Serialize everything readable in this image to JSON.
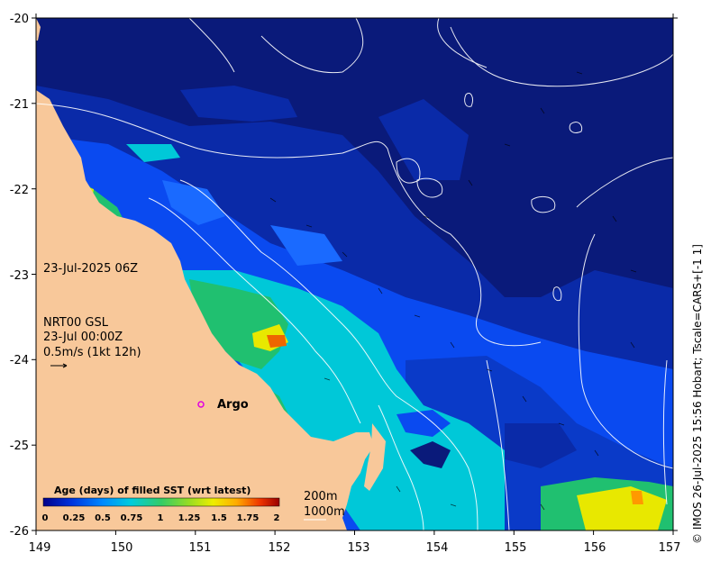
{
  "map": {
    "x_ticks": [
      "149",
      "150",
      "151",
      "152",
      "153",
      "154",
      "155",
      "156",
      "157"
    ],
    "y_ticks": [
      "-20",
      "-21",
      "-22",
      "-23",
      "-24",
      "-25",
      "-26"
    ],
    "lon_range": [
      149,
      157
    ],
    "lat_range": [
      -26,
      -20
    ]
  },
  "annotations": {
    "datetime": "23-Jul-2025 06Z",
    "current_source": "NRT00 GSL",
    "current_time": "23-Jul 00:00Z",
    "scale_vector": "0.5m/s (1kt 12h)",
    "argo_label": "Argo"
  },
  "colorbar": {
    "title": "Age (days) of filled SST (wrt latest)",
    "ticks": [
      "0",
      "0.25",
      "0.5",
      "0.75",
      "1",
      "1.25",
      "1.5",
      "1.75",
      "2"
    ],
    "colors": [
      "#00008b",
      "#0022cc",
      "#0055ff",
      "#0099ff",
      "#00ccdd",
      "#22cc88",
      "#55dd33",
      "#aaee22",
      "#eeee00",
      "#ffbb00",
      "#ff7700",
      "#ee3300",
      "#aa0000"
    ]
  },
  "contours": {
    "label_200": "200m",
    "label_1000": "1000m"
  },
  "credit": "© IMOS 26-Jul-2025 15:56 Hobart; Tscale=CARS+[-1 1]",
  "palette": {
    "land": "#f8c89a",
    "deep_navy": "#0a1a7a",
    "mid_blue": "#0a3ac8",
    "bright_blue": "#1a6aff",
    "cyan": "#00c8d8",
    "green": "#20c070",
    "yellow": "#e8e800"
  }
}
